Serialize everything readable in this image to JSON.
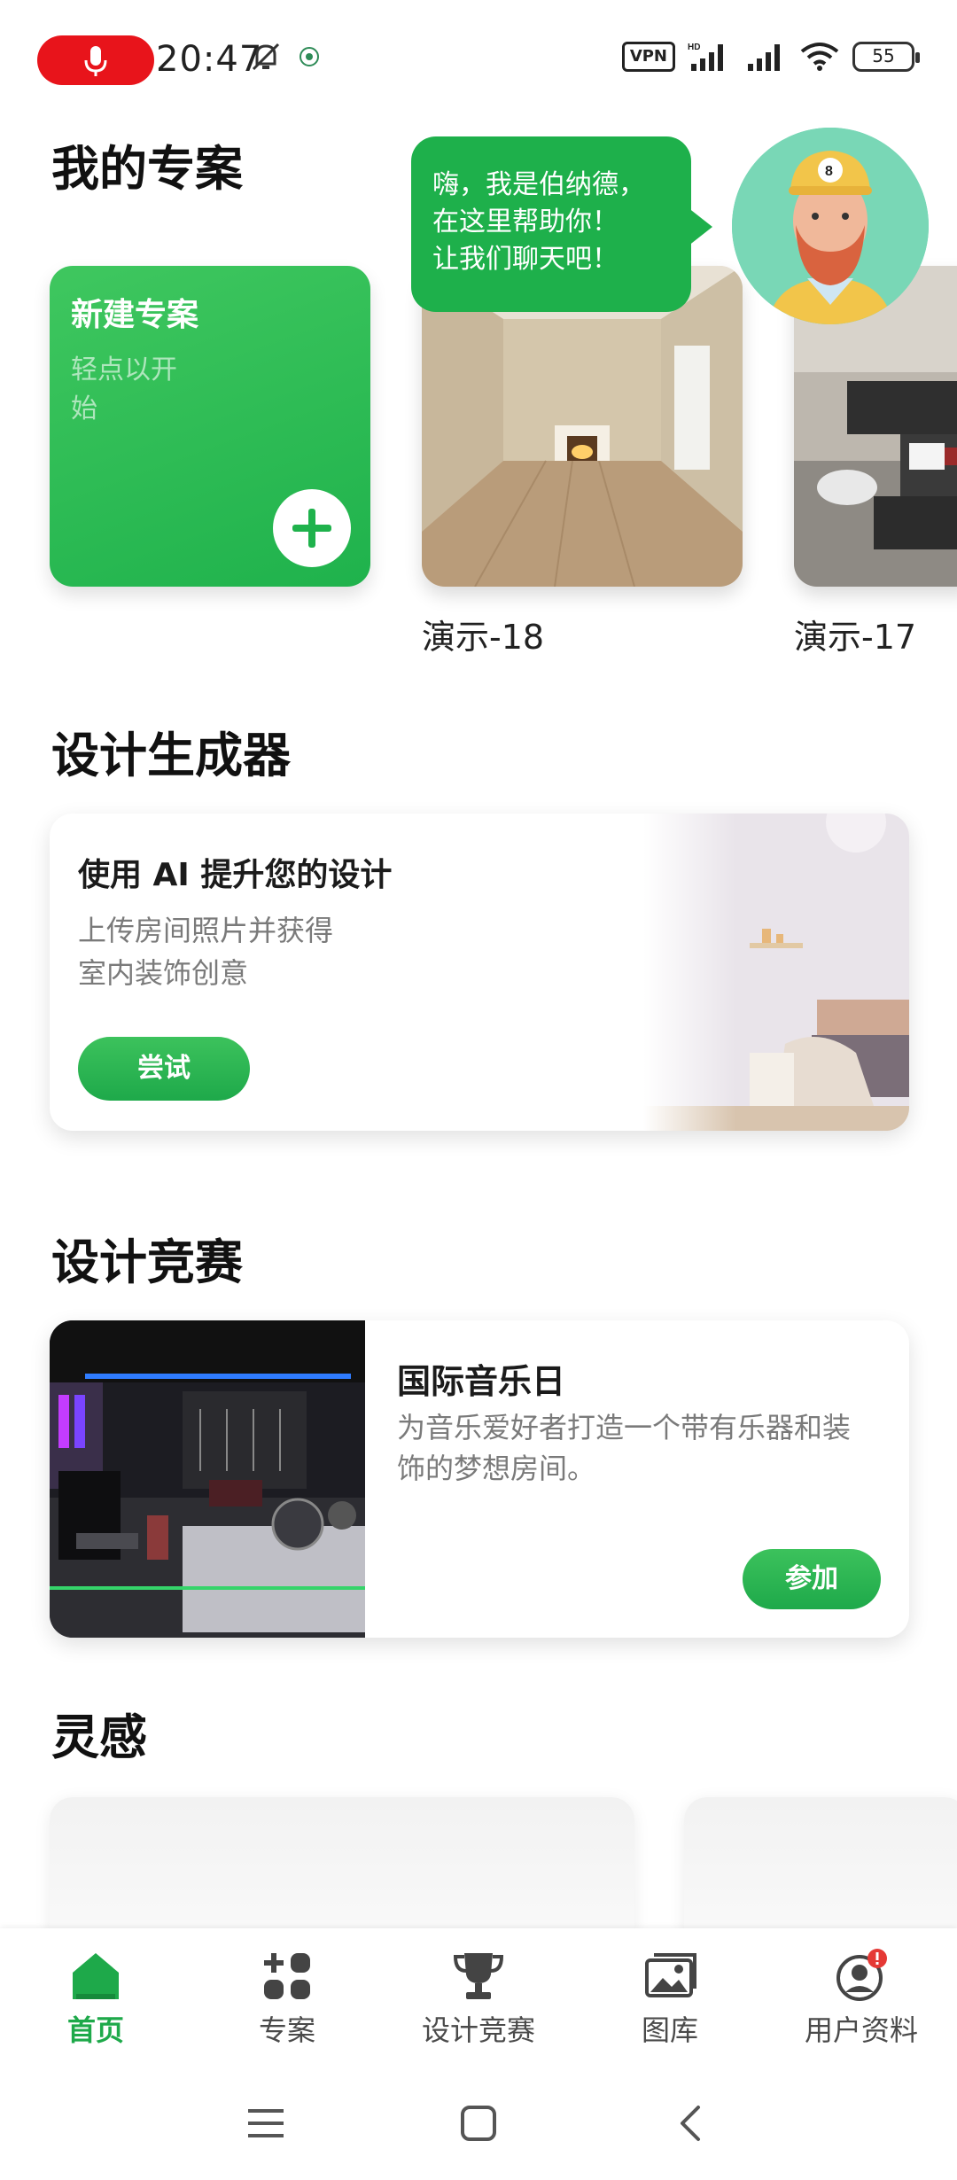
{
  "status_bar": {
    "time": "20:47",
    "vpn_label": "VPN",
    "battery_level": "55",
    "icons": [
      "mic-icon",
      "bell-muted-icon",
      "app-notification-icon",
      "signal-icon",
      "wifi-icon",
      "battery-icon"
    ]
  },
  "projects": {
    "section_title": "我的专案",
    "new_card": {
      "title": "新建专案",
      "hint": "轻点以开始"
    },
    "demos": [
      {
        "label": "演示-18"
      },
      {
        "label": "演示-17"
      }
    ]
  },
  "chat_bubble": {
    "lines": [
      "嗨，我是伯纳德，",
      "在这里帮助你！",
      "让我们聊天吧！"
    ]
  },
  "generator": {
    "section_title": "设计生成器",
    "card_title": "使用 AI 提升您的设计",
    "desc_line1": "上传房间照片并获得",
    "desc_line2": "室内装饰创意",
    "button_label": "尝试"
  },
  "contest": {
    "section_title": "设计竞赛",
    "card_title": "国际音乐日",
    "desc": "为音乐爱好者打造一个带有乐器和装饰的梦想房间。",
    "button_label": "参加"
  },
  "inspiration": {
    "section_title": "灵感"
  },
  "bottom_nav": {
    "items": [
      {
        "label": "首页",
        "icon": "home-icon",
        "active": true
      },
      {
        "label": "专案",
        "icon": "projects-grid-icon",
        "active": false
      },
      {
        "label": "设计竞赛",
        "icon": "trophy-icon",
        "active": false
      },
      {
        "label": "图库",
        "icon": "gallery-icon",
        "active": false
      },
      {
        "label": "用户资料",
        "icon": "user-profile-icon",
        "active": false
      }
    ]
  },
  "colors": {
    "accent": "#1ea94a",
    "status_red": "#e8141b"
  }
}
